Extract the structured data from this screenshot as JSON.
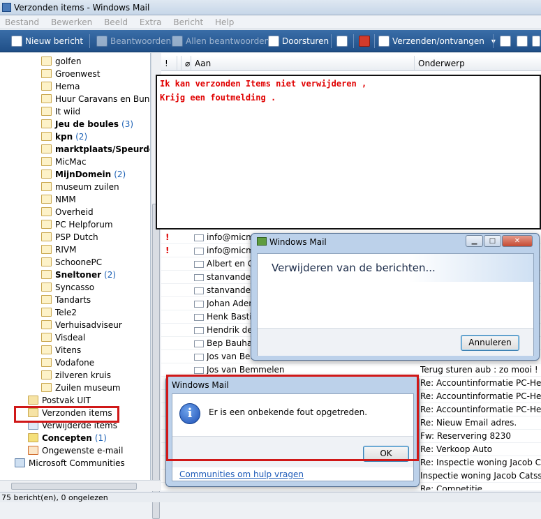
{
  "window": {
    "title": "Verzonden items - Windows Mail"
  },
  "menu": [
    "Bestand",
    "Bewerken",
    "Beeld",
    "Extra",
    "Bericht",
    "Help"
  ],
  "toolbar": {
    "new_message": "Nieuw bericht",
    "reply": "Beantwoorden",
    "reply_all": "Allen beantwoorden",
    "forward": "Doorsturen",
    "send_receive": "Verzenden/ontvangen"
  },
  "folders": [
    {
      "label": "golfen",
      "count": "",
      "bold": false
    },
    {
      "label": "Groenwest",
      "count": "",
      "bold": false
    },
    {
      "label": "Hema",
      "count": "",
      "bold": false
    },
    {
      "label": "Huur Caravans en Bungal",
      "count": "",
      "bold": false
    },
    {
      "label": "It wiid",
      "count": "",
      "bold": false
    },
    {
      "label": "Jeu de boules",
      "count": "(3)",
      "bold": true
    },
    {
      "label": "kpn",
      "count": "(2)",
      "bold": true
    },
    {
      "label": "marktplaats/Speurders",
      "count": "(",
      "bold": true
    },
    {
      "label": "MicMac",
      "count": "",
      "bold": false
    },
    {
      "label": "MijnDomein",
      "count": "(2)",
      "bold": true
    },
    {
      "label": "museum zuilen",
      "count": "",
      "bold": false
    },
    {
      "label": "NMM",
      "count": "",
      "bold": false
    },
    {
      "label": "Overheid",
      "count": "",
      "bold": false
    },
    {
      "label": "PC Helpforum",
      "count": "",
      "bold": false
    },
    {
      "label": "PSP Dutch",
      "count": "",
      "bold": false
    },
    {
      "label": "RIVM",
      "count": "",
      "bold": false
    },
    {
      "label": "SchoonePC",
      "count": "",
      "bold": false
    },
    {
      "label": "Sneltoner",
      "count": "(2)",
      "bold": true
    },
    {
      "label": "Syncasso",
      "count": "",
      "bold": false
    },
    {
      "label": "Tandarts",
      "count": "",
      "bold": false
    },
    {
      "label": "Tele2",
      "count": "",
      "bold": false
    },
    {
      "label": "Verhuisadviseur",
      "count": "",
      "bold": false
    },
    {
      "label": "Visdeal",
      "count": "",
      "bold": false
    },
    {
      "label": "Vitens",
      "count": "",
      "bold": false
    },
    {
      "label": "Vodafone",
      "count": "",
      "bold": false
    },
    {
      "label": "zilveren kruis",
      "count": "",
      "bold": false
    },
    {
      "label": "Zuilen museum",
      "count": "",
      "bold": false
    }
  ],
  "root_folders": {
    "outbox": "Postvak UIT",
    "sent": "Verzonden items",
    "deleted": "Verwijderde items",
    "drafts": "Concepten",
    "drafts_count": "(1)",
    "junk": "Ongewenste e-mail",
    "communities": "Microsoft Communities"
  },
  "columns": {
    "importance": "!",
    "attachment": "",
    "to": "Aan",
    "subject": "Onderwerp"
  },
  "messages": [
    {
      "imp": "!",
      "to": "info@micm",
      "subject": ""
    },
    {
      "imp": "!",
      "to": "info@micm",
      "subject": ""
    },
    {
      "imp": "",
      "to": "Albert en Ge",
      "subject": ""
    },
    {
      "imp": "",
      "to": "stanvandenh",
      "subject": ""
    },
    {
      "imp": "",
      "to": "stanvandenh",
      "subject": ""
    },
    {
      "imp": "",
      "to": "Johan Adem",
      "subject": ""
    },
    {
      "imp": "",
      "to": "Henk Bastia",
      "subject": ""
    },
    {
      "imp": "",
      "to": "Hendrik de G",
      "subject": ""
    },
    {
      "imp": "",
      "to": "Bep Bauhau",
      "subject": ""
    },
    {
      "imp": "",
      "to": "Jos van Bem",
      "subject": ""
    },
    {
      "imp": "",
      "to": "Jos van Bemmelen",
      "subject": "Terug sturen aub : zo mooi !"
    },
    {
      "imp": "",
      "to": "",
      "subject": "Re: Accountinformatie PC-Helpfor"
    },
    {
      "imp": "",
      "to": "",
      "subject": "Re: Accountinformatie PC-Helpfor"
    },
    {
      "imp": "",
      "to": "",
      "subject": "Re: Accountinformatie PC-Helpfor"
    },
    {
      "imp": "",
      "to": "",
      "subject": "Re: Nieuw Email adres."
    },
    {
      "imp": "",
      "to": "",
      "subject": "Fw: Reservering 8230"
    },
    {
      "imp": "",
      "to": "",
      "subject": "Re: Verkoop Auto"
    },
    {
      "imp": "",
      "to": "",
      "subject": "Re: Inspectie woning Jacob Catsst"
    },
    {
      "imp": "",
      "to": "",
      "subject": "Inspectie woning Jacob Catsstraa"
    },
    {
      "imp": "",
      "to": "",
      "subject": "Re: Competitie"
    }
  ],
  "annotation": {
    "line1": "Ik kan verzonden Items niet verwijderen ,",
    "line2": "Krijg een foutmelding ."
  },
  "dialog_delete": {
    "title": "Windows Mail",
    "heading": "Verwijderen van de berichten...",
    "cancel": "Annuleren"
  },
  "dialog_error": {
    "title": "Windows Mail",
    "message": "Er is een onbekende fout opgetreden.",
    "ok": "OK",
    "link": "Communities om hulp vragen"
  },
  "status": "75 bericht(en), 0 ongelezen",
  "colors": {
    "accent_red": "#d01818",
    "toolbar": "#1f4f87",
    "link": "#1c5ab8"
  }
}
